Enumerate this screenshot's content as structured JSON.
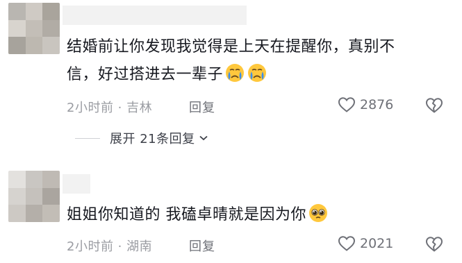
{
  "comments": [
    {
      "text_line1": "结婚前让你发现我觉得是上天在提醒你，真别不",
      "text_line2": "信，好过搭进去一辈子",
      "emojis": [
        "crying-face-icon",
        "crying-face-icon"
      ],
      "meta": "2小时前 · 吉林",
      "reply_label": "回复",
      "likes": "2876",
      "expand_label": "展开 21条回复"
    },
    {
      "text_line1": "姐姐你知道的 我磕卓晴就是因为你",
      "emojis": [
        "pleading-face-icon"
      ],
      "meta": "2小时前 · 湖南",
      "reply_label": "回复",
      "likes": "2021"
    }
  ],
  "colors": {
    "text": "#16181f",
    "meta": "#9a9ca2",
    "action": "#6e7077",
    "emoji_yellow": "#ffc83d",
    "emoji_tear": "#3b8eea"
  }
}
